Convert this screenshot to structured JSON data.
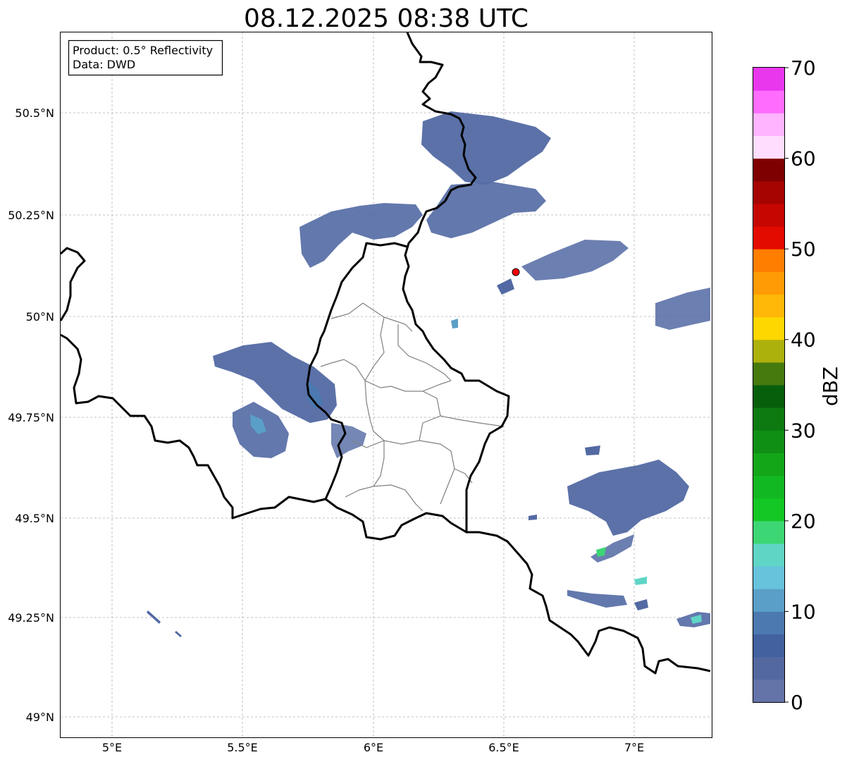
{
  "title": "08.12.2025 08:38 UTC",
  "info_box": {
    "product": "Product: 0.5° Reflectivity",
    "data": "Data: DWD"
  },
  "axes": {
    "lat_ticks": [
      "50.5°N",
      "50.25°N",
      "50°N",
      "49.75°N",
      "49.5°N",
      "49.25°N",
      "49°N"
    ],
    "lon_ticks": [
      "5°E",
      "5.5°E",
      "6°E",
      "6.5°E",
      "7°E"
    ],
    "lon_range": [
      4.8,
      7.3
    ],
    "lat_range": [
      48.95,
      50.7
    ]
  },
  "colorbar": {
    "label": "dBZ",
    "tick_labels": [
      "0",
      "10",
      "20",
      "30",
      "40",
      "50",
      "60",
      "70"
    ],
    "colors": [
      "#6473a8",
      "#5468a0",
      "#43609f",
      "#4b79b0",
      "#5a9fc8",
      "#67c2dc",
      "#5fd5c6",
      "#3dd674",
      "#13c724",
      "#12b821",
      "#13a619",
      "#0f8f14",
      "#0c7a10",
      "#075f0c",
      "#467a0f",
      "#adb10c",
      "#fed700",
      "#ffb807",
      "#ff9c05",
      "#ff7e00",
      "#e30a00",
      "#c60600",
      "#a60400",
      "#7f0000",
      "#ffddff",
      "#ffb4ff",
      "#ff6cfe",
      "#e937ee"
    ]
  },
  "radar_site": {
    "lon": 6.55,
    "lat": 50.11,
    "color": "#ff0000"
  },
  "colors": {
    "border": "#000000",
    "admin": "#808080",
    "grid": "#b0b0b0"
  }
}
